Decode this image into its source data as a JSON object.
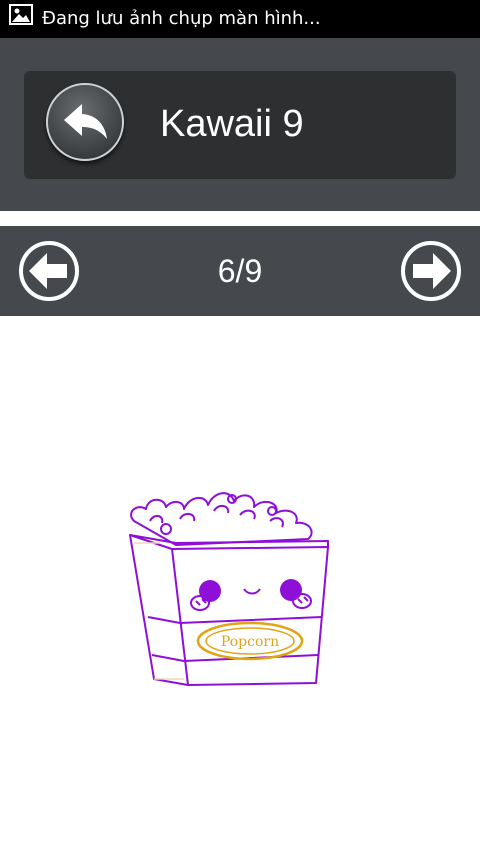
{
  "status_bar": {
    "notification_text": "Đang lưu ảnh chụp màn hình...",
    "icon": "image-icon"
  },
  "header": {
    "title": "Kawaii 9",
    "back_icon": "reply-arrow-icon"
  },
  "navigation": {
    "page_indicator": "6/9",
    "prev_icon": "arrow-left-circle-icon",
    "next_icon": "arrow-right-circle-icon"
  },
  "drawing": {
    "label_text": "Popcorn",
    "stroke_color": "#8e0fd8",
    "accent_color": "#e2a417"
  },
  "colors": {
    "status_bar": "#000000",
    "header_bg": "#45494d",
    "card_bg": "#2d2f31",
    "canvas_bg": "#ffffff"
  }
}
